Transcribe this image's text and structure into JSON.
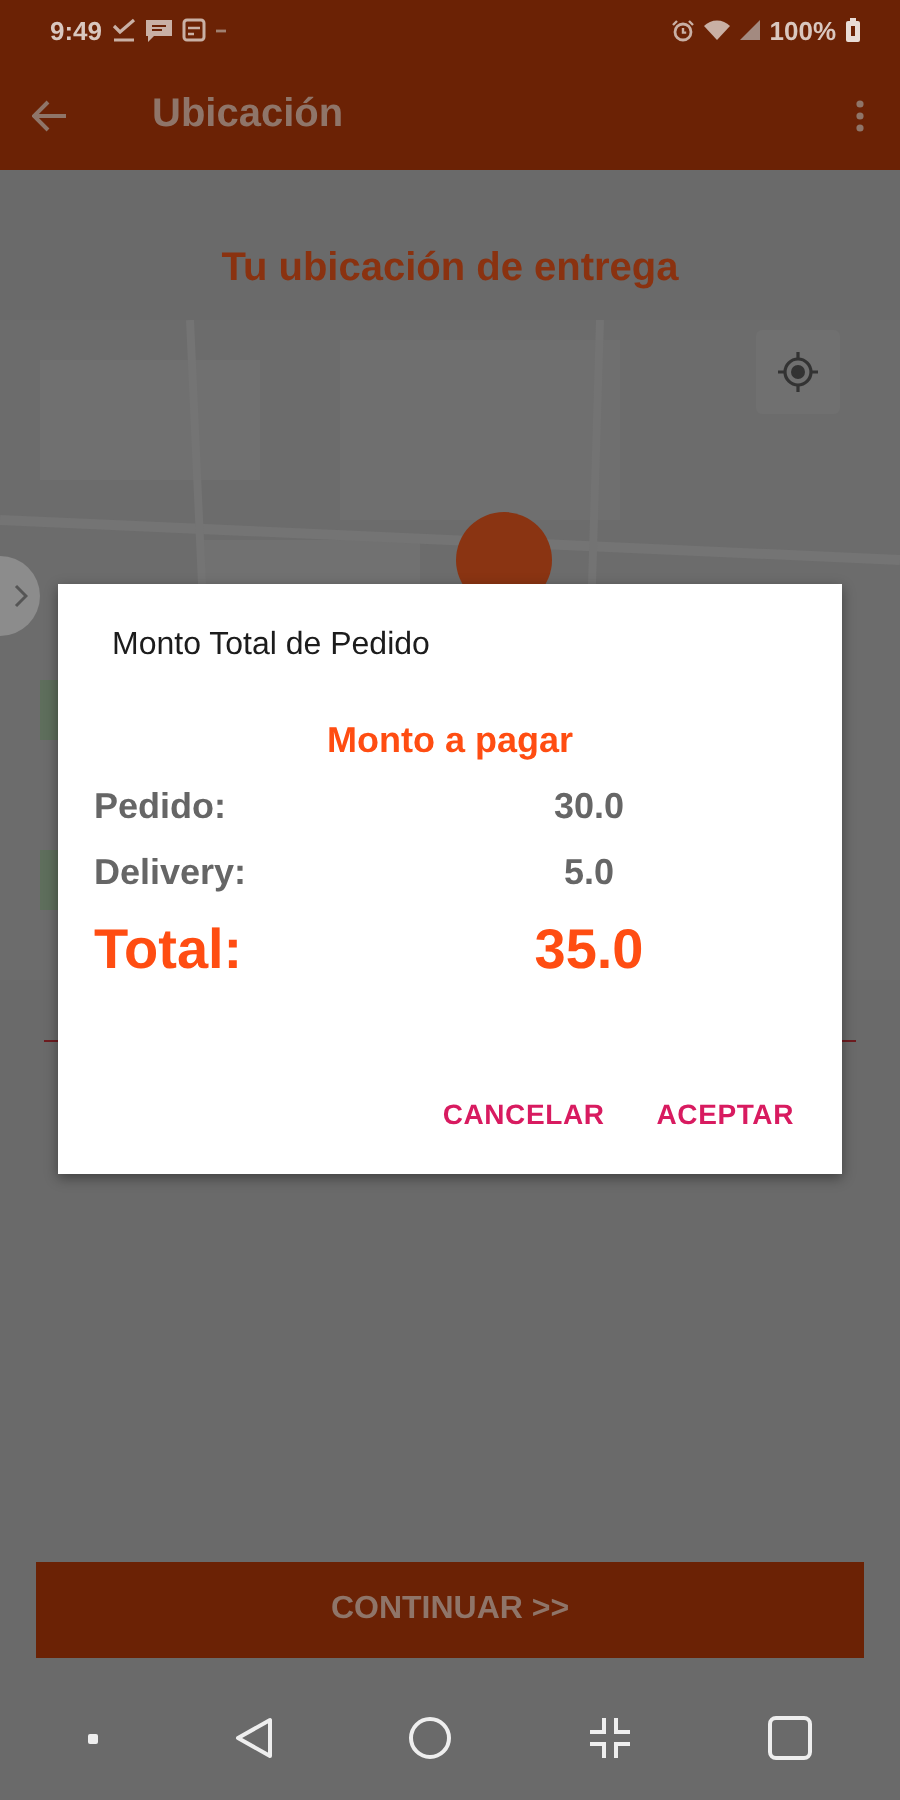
{
  "status_bar": {
    "time": "9:49",
    "battery": "100%"
  },
  "app_bar": {
    "title": "Ubicación"
  },
  "page_title": "Tu ubicación de entrega",
  "continue_button": "CONTINUAR >>",
  "dialog": {
    "title": "Monto Total de Pedido",
    "subtitle": "Monto a pagar",
    "lines": [
      {
        "kind": "line",
        "label": "Pedido:",
        "value": "30.0"
      },
      {
        "kind": "line",
        "label": "Delivery:",
        "value": "5.0"
      },
      {
        "kind": "total",
        "label": "Total:",
        "value": "35.0"
      }
    ],
    "buttons": [
      "CANCELAR",
      "ACEPTAR"
    ]
  }
}
